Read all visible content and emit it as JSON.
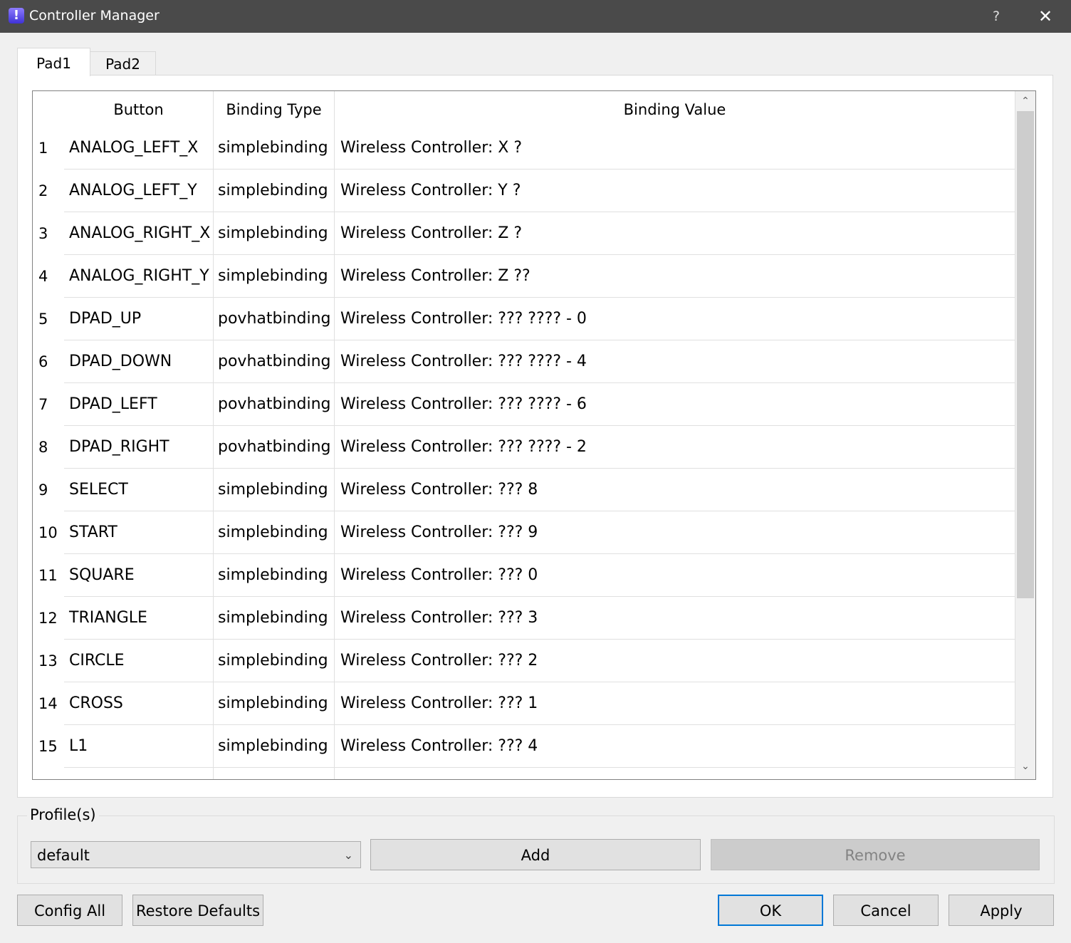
{
  "window": {
    "title": "Controller Manager",
    "help_glyph": "?",
    "close_glyph": "✕",
    "icon": "exclamation-app-icon",
    "icon_glyph": "!"
  },
  "tabs": [
    {
      "label": "Pad1",
      "active": true
    },
    {
      "label": "Pad2",
      "active": false
    }
  ],
  "table": {
    "headers": {
      "button": "Button",
      "binding_type": "Binding Type",
      "binding_value": "Binding Value"
    },
    "rows": [
      {
        "num": "1",
        "button": "ANALOG_LEFT_X",
        "type": "simplebinding",
        "value": "Wireless Controller: X ?"
      },
      {
        "num": "2",
        "button": "ANALOG_LEFT_Y",
        "type": "simplebinding",
        "value": "Wireless Controller: Y ?"
      },
      {
        "num": "3",
        "button": "ANALOG_RIGHT_X",
        "type": "simplebinding",
        "value": "Wireless Controller: Z ?"
      },
      {
        "num": "4",
        "button": "ANALOG_RIGHT_Y",
        "type": "simplebinding",
        "value": "Wireless Controller: Z ??"
      },
      {
        "num": "5",
        "button": "DPAD_UP",
        "type": "povhatbinding",
        "value": "Wireless Controller: ??? ???? - 0"
      },
      {
        "num": "6",
        "button": "DPAD_DOWN",
        "type": "povhatbinding",
        "value": "Wireless Controller: ??? ???? - 4"
      },
      {
        "num": "7",
        "button": "DPAD_LEFT",
        "type": "povhatbinding",
        "value": "Wireless Controller: ??? ???? - 6"
      },
      {
        "num": "8",
        "button": "DPAD_RIGHT",
        "type": "povhatbinding",
        "value": "Wireless Controller: ??? ???? - 2"
      },
      {
        "num": "9",
        "button": "SELECT",
        "type": "simplebinding",
        "value": "Wireless Controller: ??? 8"
      },
      {
        "num": "10",
        "button": "START",
        "type": "simplebinding",
        "value": "Wireless Controller: ??? 9"
      },
      {
        "num": "11",
        "button": "SQUARE",
        "type": "simplebinding",
        "value": "Wireless Controller: ??? 0"
      },
      {
        "num": "12",
        "button": "TRIANGLE",
        "type": "simplebinding",
        "value": "Wireless Controller: ??? 3"
      },
      {
        "num": "13",
        "button": "CIRCLE",
        "type": "simplebinding",
        "value": "Wireless Controller: ??? 2"
      },
      {
        "num": "14",
        "button": "CROSS",
        "type": "simplebinding",
        "value": "Wireless Controller: ??? 1"
      },
      {
        "num": "15",
        "button": "L1",
        "type": "simplebinding",
        "value": "Wireless Controller: ??? 4"
      },
      {
        "num": "",
        "button": "",
        "type": "",
        "value": ""
      }
    ]
  },
  "scrollbar": {
    "up_glyph": "⌃",
    "down_glyph": "⌄"
  },
  "profiles": {
    "group_label": "Profile(s)",
    "selected": "default",
    "arrow_glyph": "⌄",
    "add_label": "Add",
    "remove_label": "Remove"
  },
  "footer": {
    "config_all_label": "Config All",
    "restore_defaults_label": "Restore Defaults",
    "ok_label": "OK",
    "cancel_label": "Cancel",
    "apply_label": "Apply"
  }
}
